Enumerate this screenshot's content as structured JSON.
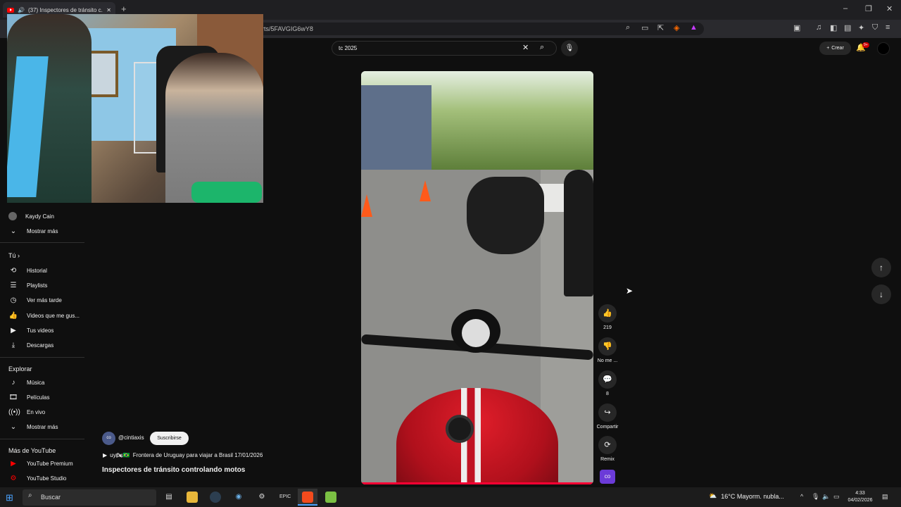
{
  "browser": {
    "tab_title": "(37) Inspectores de tránsito c...",
    "url": "rts/5FAVGIG6wY8",
    "new_tab": "+",
    "window_controls": [
      "–",
      "❐",
      "✕"
    ]
  },
  "header": {
    "search_query": "tc 2025",
    "create_label": "Crear",
    "notif_badge": "9+"
  },
  "sidebar": {
    "subs_tail": {
      "name": "Kaydy Cain",
      "more": "Mostrar más"
    },
    "you_header": "Tú",
    "you_items": [
      {
        "icon": "history-icon",
        "label": "Historial"
      },
      {
        "icon": "playlists-icon",
        "label": "Playlists"
      },
      {
        "icon": "watch-later-icon",
        "label": "Ver más tarde"
      },
      {
        "icon": "liked-icon",
        "label": "Videos que me gus..."
      },
      {
        "icon": "your-videos-icon",
        "label": "Tus videos"
      },
      {
        "icon": "downloads-icon",
        "label": "Descargas"
      }
    ],
    "explore_header": "Explorar",
    "explore_items": [
      {
        "icon": "music-icon",
        "label": "Música"
      },
      {
        "icon": "movies-icon",
        "label": "Películas"
      },
      {
        "icon": "live-icon",
        "label": "En vivo"
      },
      {
        "icon": "chevron-down-icon",
        "label": "Mostrar más"
      }
    ],
    "more_header": "Más de YouTube",
    "more_items": [
      {
        "icon": "yt-premium-icon",
        "label": "YouTube Premium"
      },
      {
        "icon": "yt-studio-icon",
        "label": "YouTube Studio"
      }
    ]
  },
  "short": {
    "channel": "@cintiaxis",
    "subscribe": "Suscribirse",
    "music_line_prefix": "uy🏍🇧🇷",
    "music_line": "Frontera de Uruguay para viajar a Brasil 17/01/2026",
    "title": "Inspectores de tránsito controlando motos",
    "actions": {
      "likes": "219",
      "dislike": "No me ...",
      "comments": "8",
      "share": "Compartir",
      "remix": "Remix"
    }
  },
  "taskbar": {
    "search_placeholder": "Buscar",
    "weather": "16°C  Mayorm. nubla...",
    "time": "4:33",
    "date": "04/02/2026"
  },
  "colors": {
    "accent_red": "#ff0000",
    "background": "#0f0f0f",
    "taskbar_accent": "#4aa3ff"
  }
}
